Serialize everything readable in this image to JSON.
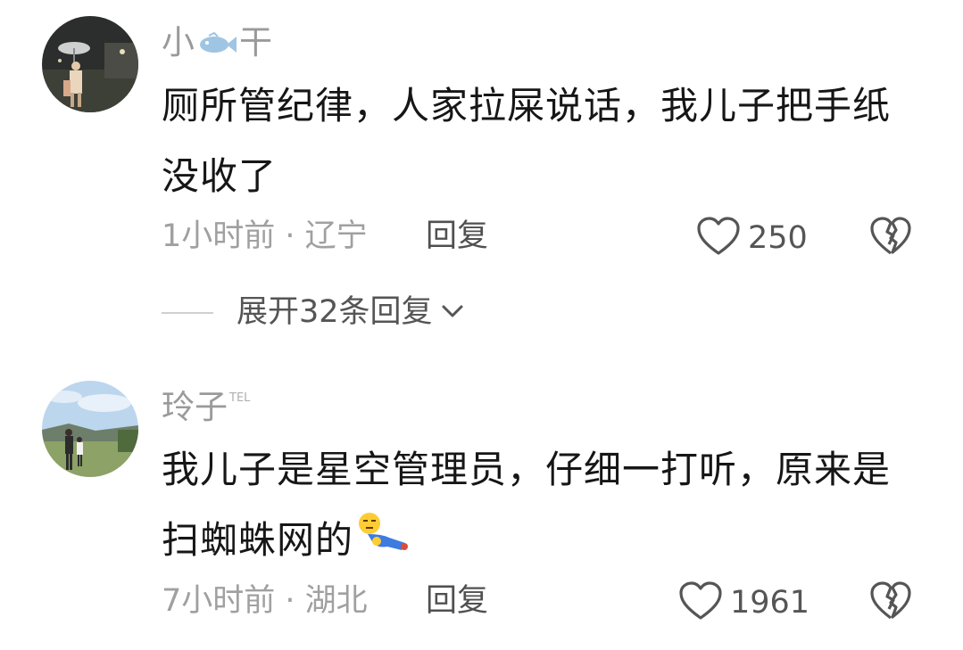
{
  "comments": [
    {
      "username_part1": "小",
      "username_part2": "干",
      "username_icon": "fish-icon",
      "text": "厕所管纪律，人家拉屎说话，我儿子把手纸没收了",
      "time_location": "1小时前 · 辽宁",
      "reply_label": "回复",
      "likes": "250",
      "expand_label": "展开32条回复"
    },
    {
      "username": "玲子",
      "badge": "TEL",
      "text": "我儿子是星空管理员，仔细一打听，原来是扫蜘蛛网的",
      "text_emoji": "lying-down-emoji",
      "time_location": "7小时前 · 湖北",
      "reply_label": "回复",
      "likes": "1961"
    }
  ],
  "colors": {
    "username": "#9a9a9a",
    "body": "#161616",
    "meta": "#a0a0a0",
    "icon": "#555555"
  }
}
